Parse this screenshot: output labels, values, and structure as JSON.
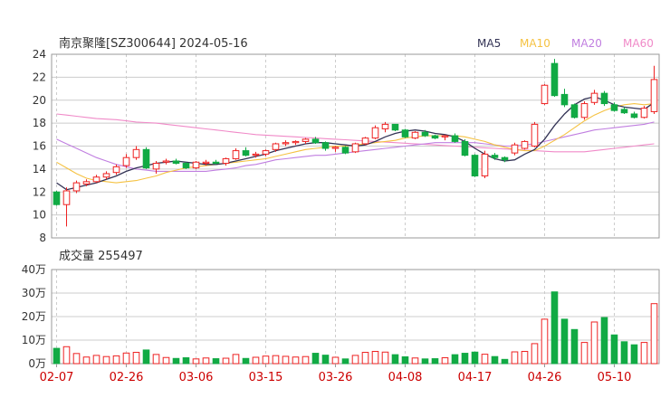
{
  "title": "南京聚隆[SZ300644] 2024-05-16",
  "volume_label": "成交量 255497",
  "colors": {
    "up": "#ee2222",
    "down": "#11aa44",
    "grid": "#cccccc",
    "axis_text": "#333333",
    "date_text": "#cc0000",
    "MA5": "#333355",
    "MA10": "#f5c242",
    "MA20": "#c07ee0",
    "MA60": "#f08ac8"
  },
  "chart_data": [
    {
      "type": "candlestick",
      "ylim": [
        8,
        24
      ],
      "yticks": [
        "24",
        "22",
        "20",
        "18",
        "16",
        "14",
        "12",
        "10",
        "8"
      ],
      "legend": [
        "MA5",
        "MA10",
        "MA20",
        "MA60"
      ],
      "legend_position": "top-right",
      "grid": true,
      "xtick_labels": [
        {
          "label": "02-07",
          "index": 0
        },
        {
          "label": "02-26",
          "index": 7
        },
        {
          "label": "03-06",
          "index": 14
        },
        {
          "label": "03-15",
          "index": 21
        },
        {
          "label": "03-26",
          "index": 28
        },
        {
          "label": "04-08",
          "index": 35
        },
        {
          "label": "04-17",
          "index": 42
        },
        {
          "label": "04-26",
          "index": 49
        },
        {
          "label": "05-10",
          "index": 56
        }
      ],
      "ohlc": [
        [
          12.0,
          12.1,
          10.8,
          10.9
        ],
        [
          10.9,
          12.4,
          9.0,
          12.1
        ],
        [
          12.1,
          13.0,
          11.9,
          12.8
        ],
        [
          12.7,
          13.1,
          12.5,
          12.9
        ],
        [
          12.9,
          13.5,
          12.8,
          13.3
        ],
        [
          13.3,
          13.8,
          13.1,
          13.6
        ],
        [
          13.7,
          14.4,
          13.5,
          14.2
        ],
        [
          14.3,
          15.3,
          14.1,
          15.0
        ],
        [
          15.0,
          16.0,
          14.8,
          15.7
        ],
        [
          15.7,
          15.9,
          14.0,
          14.1
        ],
        [
          14.0,
          14.7,
          13.6,
          14.5
        ],
        [
          14.6,
          14.9,
          14.4,
          14.7
        ],
        [
          14.7,
          14.9,
          14.4,
          14.5
        ],
        [
          14.5,
          14.6,
          14.0,
          14.1
        ],
        [
          14.1,
          14.7,
          14.0,
          14.6
        ],
        [
          14.5,
          14.8,
          14.3,
          14.6
        ],
        [
          14.6,
          14.8,
          14.4,
          14.5
        ],
        [
          14.5,
          15.0,
          14.3,
          14.9
        ],
        [
          14.9,
          15.8,
          14.8,
          15.6
        ],
        [
          15.6,
          15.9,
          15.1,
          15.2
        ],
        [
          15.2,
          15.5,
          15.0,
          15.3
        ],
        [
          15.3,
          15.7,
          15.1,
          15.6
        ],
        [
          15.7,
          16.3,
          15.5,
          16.2
        ],
        [
          16.2,
          16.5,
          16.0,
          16.3
        ],
        [
          16.3,
          16.5,
          16.1,
          16.4
        ],
        [
          16.4,
          16.7,
          16.2,
          16.6
        ],
        [
          16.6,
          16.8,
          16.2,
          16.3
        ],
        [
          16.3,
          16.4,
          15.6,
          15.8
        ],
        [
          15.8,
          16.0,
          15.5,
          15.9
        ],
        [
          15.9,
          16.0,
          15.3,
          15.4
        ],
        [
          15.5,
          16.3,
          15.4,
          16.2
        ],
        [
          16.2,
          16.8,
          16.1,
          16.7
        ],
        [
          16.7,
          17.8,
          16.6,
          17.6
        ],
        [
          17.5,
          18.1,
          17.2,
          17.9
        ],
        [
          17.9,
          17.9,
          17.3,
          17.4
        ],
        [
          17.4,
          17.5,
          16.7,
          16.8
        ],
        [
          16.7,
          17.3,
          16.6,
          17.2
        ],
        [
          17.2,
          17.4,
          16.8,
          16.9
        ],
        [
          16.9,
          17.0,
          16.6,
          16.7
        ],
        [
          16.8,
          17.0,
          16.5,
          16.9
        ],
        [
          16.9,
          17.1,
          16.3,
          16.4
        ],
        [
          16.4,
          16.6,
          15.1,
          15.2
        ],
        [
          15.2,
          15.3,
          13.3,
          13.4
        ],
        [
          13.4,
          15.6,
          13.2,
          15.3
        ],
        [
          15.2,
          15.4,
          14.8,
          15.0
        ],
        [
          15.0,
          15.1,
          14.6,
          14.8
        ],
        [
          15.4,
          16.3,
          15.2,
          16.1
        ],
        [
          15.8,
          16.5,
          15.7,
          16.4
        ],
        [
          16.0,
          18.1,
          15.9,
          17.9
        ],
        [
          19.7,
          21.4,
          19.6,
          21.3
        ],
        [
          23.2,
          23.6,
          20.3,
          20.4
        ],
        [
          20.5,
          21.0,
          19.4,
          19.6
        ],
        [
          19.6,
          19.7,
          18.4,
          18.5
        ],
        [
          18.5,
          19.9,
          18.3,
          19.7
        ],
        [
          19.8,
          20.9,
          19.6,
          20.6
        ],
        [
          20.6,
          20.8,
          19.5,
          19.7
        ],
        [
          19.6,
          19.8,
          19.0,
          19.1
        ],
        [
          19.2,
          19.4,
          18.8,
          18.9
        ],
        [
          18.8,
          19.0,
          18.4,
          18.5
        ],
        [
          18.5,
          19.5,
          18.4,
          19.3
        ],
        [
          19.0,
          23.0,
          18.8,
          21.8
        ]
      ],
      "ma": {
        "MA5": [
          12.8,
          12.2,
          12.4,
          12.6,
          12.8,
          13.1,
          13.4,
          13.8,
          14.1,
          14.3,
          14.5,
          14.6,
          14.7,
          14.6,
          14.5,
          14.4,
          14.4,
          14.5,
          14.7,
          14.9,
          15.1,
          15.3,
          15.6,
          15.8,
          16.0,
          16.2,
          16.3,
          16.3,
          16.2,
          16.1,
          16.0,
          16.1,
          16.4,
          16.8,
          17.1,
          17.3,
          17.4,
          17.3,
          17.1,
          17.0,
          16.8,
          16.4,
          15.8,
          15.3,
          14.9,
          14.7,
          14.8,
          15.3,
          15.7,
          16.6,
          17.8,
          18.8,
          19.6,
          20.1,
          20.3,
          20.0,
          19.6,
          19.4,
          19.3,
          19.2,
          19.8
        ],
        "MA10": [
          14.6,
          14.1,
          13.6,
          13.2,
          13.0,
          12.9,
          12.8,
          12.9,
          13.0,
          13.2,
          13.4,
          13.7,
          13.9,
          14.1,
          14.2,
          14.3,
          14.4,
          14.5,
          14.6,
          14.7,
          14.8,
          14.9,
          15.1,
          15.3,
          15.5,
          15.7,
          15.8,
          15.9,
          16.0,
          16.0,
          16.1,
          16.2,
          16.3,
          16.4,
          16.5,
          16.7,
          16.8,
          16.9,
          16.9,
          16.9,
          16.9,
          16.8,
          16.6,
          16.4,
          16.1,
          15.9,
          15.7,
          15.6,
          15.6,
          16.0,
          16.5,
          17.0,
          17.6,
          18.2,
          18.7,
          19.1,
          19.4,
          19.6,
          19.7,
          19.6,
          19.7
        ],
        "MA20": [
          16.6,
          16.2,
          15.8,
          15.4,
          15.0,
          14.7,
          14.4,
          14.2,
          14.0,
          13.9,
          13.8,
          13.8,
          13.8,
          13.8,
          13.8,
          13.8,
          13.9,
          14.0,
          14.1,
          14.3,
          14.4,
          14.6,
          14.8,
          14.9,
          15.0,
          15.1,
          15.2,
          15.2,
          15.3,
          15.4,
          15.5,
          15.6,
          15.7,
          15.8,
          15.9,
          16.0,
          16.1,
          16.2,
          16.3,
          16.3,
          16.3,
          16.3,
          16.3,
          16.2,
          16.1,
          16.0,
          16.0,
          16.1,
          16.2,
          16.4,
          16.6,
          16.8,
          17.0,
          17.2,
          17.4,
          17.5,
          17.6,
          17.7,
          17.8,
          17.9,
          18.1
        ],
        "MA60": [
          18.8,
          18.7,
          18.6,
          18.5,
          18.4,
          18.35,
          18.3,
          18.2,
          18.1,
          18.05,
          18.0,
          17.9,
          17.8,
          17.7,
          17.6,
          17.5,
          17.4,
          17.3,
          17.2,
          17.1,
          17.0,
          16.95,
          16.9,
          16.85,
          16.8,
          16.75,
          16.7,
          16.65,
          16.6,
          16.55,
          16.5,
          16.45,
          16.4,
          16.35,
          16.3,
          16.25,
          16.2,
          16.15,
          16.1,
          16.05,
          16.0,
          15.95,
          15.9,
          15.85,
          15.8,
          15.75,
          15.7,
          15.65,
          15.6,
          15.55,
          15.5,
          15.5,
          15.5,
          15.5,
          15.6,
          15.7,
          15.8,
          15.9,
          16.0,
          16.1,
          16.2
        ]
      }
    },
    {
      "type": "bar",
      "name": "volume",
      "unit": "万",
      "ylim": [
        0,
        40
      ],
      "yticks": [
        "40万",
        "30万",
        "20万",
        "10万",
        "0万"
      ],
      "values": [
        6.5,
        7.2,
        4.3,
        2.8,
        3.5,
        3.0,
        3.3,
        4.5,
        4.8,
        5.8,
        3.9,
        2.6,
        2.2,
        2.5,
        2.0,
        2.4,
        2.1,
        2.3,
        3.9,
        2.2,
        2.7,
        3.2,
        3.4,
        3.1,
        2.8,
        3.0,
        4.4,
        3.6,
        2.7,
        2.0,
        3.5,
        4.8,
        5.2,
        4.9,
        3.8,
        2.9,
        2.4,
        2.0,
        2.1,
        2.5,
        3.8,
        4.4,
        4.9,
        4.0,
        3.0,
        1.8,
        5.0,
        5.2,
        8.5,
        18.9,
        30.5,
        18.9,
        14.5,
        9.0,
        17.7,
        19.6,
        12.2,
        9.3,
        8.0,
        9.0,
        25.5
      ]
    }
  ]
}
